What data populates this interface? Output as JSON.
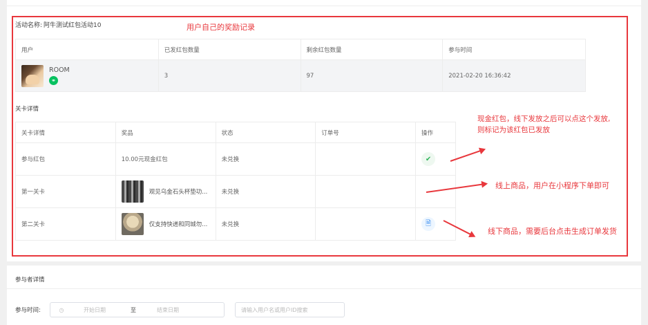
{
  "activity": {
    "label": "活动名称:",
    "name": "阿牛测试红包活动10"
  },
  "records_table": {
    "headers": [
      "用户",
      "已发红包数量",
      "剩余红包数量",
      "参与时间"
    ],
    "row": {
      "user_name": "ROOM",
      "sent": "3",
      "remaining": "97",
      "time": "2021-02-20 16:36:42"
    }
  },
  "levels": {
    "title": "关卡详情",
    "headers": [
      "关卡详情",
      "奖品",
      "状态",
      "订单号",
      "操作"
    ],
    "rows": [
      {
        "level": "参与红包",
        "prize": "10.00元现金红包",
        "status": "未兑换",
        "order": "",
        "op_icon": "check-icon"
      },
      {
        "level": "第一关卡",
        "prize": "观见乌金石头杯垫功...",
        "status": "未兑换",
        "order": "",
        "op_icon": ""
      },
      {
        "level": "第二关卡",
        "prize": "仅支持快递和同城勿...",
        "status": "未兑换",
        "order": "",
        "op_icon": "document-icon"
      }
    ]
  },
  "annotations": {
    "records_note": "用户自己的奖励记录",
    "cash_note_1": "现金红包，线下发放之后可以点这个发放,",
    "cash_note_2": "则标记为该红包已发放",
    "online_note": "线上商品，用户在小程序下单即可",
    "offline_note": "线下商品，需要后台点击生成订单发货",
    "color": "#e8373c"
  },
  "participants": {
    "title": "参与者详情",
    "time_label": "参与时间:",
    "start_placeholder": "开始日期",
    "range_sep": "至",
    "end_placeholder": "结束日期",
    "search_placeholder": "请输入用户名或用户ID搜索"
  }
}
